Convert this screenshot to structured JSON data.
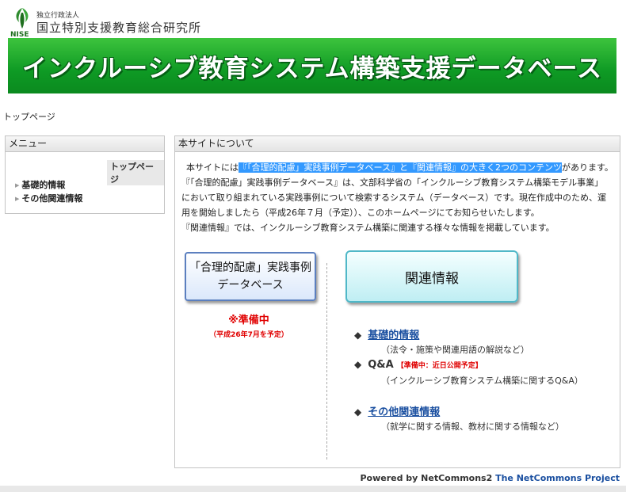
{
  "header": {
    "org_sub": "独立行政法人",
    "org_name": "国立特別支援教育総合研究所",
    "logo_text": "NISE",
    "banner_title": "インクルーシブ教育システム構築支援データベース"
  },
  "breadcrumb": "トップページ",
  "menu": {
    "title": "メニュー",
    "top_item": "トップページ",
    "items": [
      "基礎的情報",
      "その他関連情報"
    ]
  },
  "about": {
    "title": "本サイトについて",
    "line1_prefix": "本サイトには",
    "line1_highlight": "『「合理的配慮」実践事例データベース』と『関連情報』の大きく2つのコンテンツ",
    "line1_suffix": "があります。",
    "line2": "『「合理的配慮」実践事例データベース』は、文部科学省の「インクルーシブ教育システム構築モデル事業」",
    "line3": "において取り組まれている実践事例について検索するシステム（データベース）です。現在作成中のため、運",
    "line4": "用を開始しましたら（平成26年７月（予定））、このホームページにてお知らせいたします。",
    "line5": "『関連情報』では、インクルーシブ教育システム構築に関連する様々な情報を掲載しています。"
  },
  "db_button": {
    "line1": "「合理的配慮」実践事例",
    "line2": "データベース",
    "status": "※準備中",
    "date": "（平成26年7月を予定）"
  },
  "info_button": {
    "label": "関連情報"
  },
  "info_links": [
    {
      "label": "基礎的情報",
      "desc": "（法令・施策や関連用語の解説など）"
    },
    {
      "label": "Q&A",
      "note": "【準備中：近日公開予定】",
      "desc": "（インクルーシブ教育システム構築に関するQ&A）"
    },
    {
      "label": "その他関連情報",
      "desc": "（就学に関する情報、教材に関する情報など）"
    }
  ],
  "footer": {
    "powered_prefix": "Powered by NetCommons2 ",
    "project": "The NetCommons Project"
  }
}
